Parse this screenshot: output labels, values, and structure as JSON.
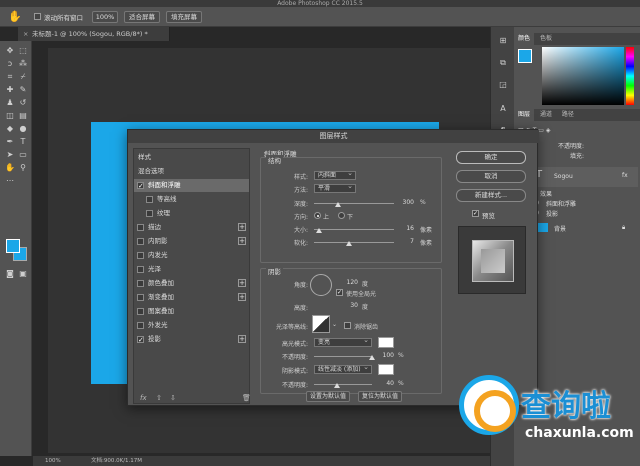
{
  "window": {
    "title": "Adobe Photoshop CC 2015.5"
  },
  "options_bar": {
    "scroll_all_label": "滚动所有窗口",
    "zoom_button": "100%",
    "fit_screen_button": "适合屏幕",
    "fill_screen_button": "填充屏幕"
  },
  "document_tab": {
    "title": "未标题-1 @ 100% (Sogou, RGB/8*) *"
  },
  "status_bar": {
    "zoom": "100%",
    "doc_info": "文档:900.0K/1.17M"
  },
  "colors": {
    "accent": "#1ba7e8",
    "panel": "#535353",
    "dark": "#282828"
  },
  "right_panel": {
    "color_tabs": [
      "颜色",
      "色板"
    ],
    "mid_tabs": [
      "图层",
      "通道",
      "路径"
    ],
    "layers": {
      "opacity_label": "不透明度:",
      "fill_label": "填充:",
      "text_layer_name": "Sogou",
      "effects_label": "效果",
      "effect_bevel": "斜面和浮雕",
      "effect_shadow": "投影",
      "bg_layer_name": "背景",
      "fx_label": "fx"
    }
  },
  "dialog": {
    "title": "图层样式",
    "style_items": [
      {
        "label": "样式"
      },
      {
        "label": "混合选项"
      },
      {
        "label": "斜面和浮雕"
      },
      {
        "label": "等高线"
      },
      {
        "label": "纹理"
      },
      {
        "label": "描边"
      },
      {
        "label": "内阴影"
      },
      {
        "label": "内发光"
      },
      {
        "label": "光泽"
      },
      {
        "label": "颜色叠加"
      },
      {
        "label": "渐变叠加"
      },
      {
        "label": "图案叠加"
      },
      {
        "label": "外发光"
      },
      {
        "label": "投影"
      }
    ],
    "bevel": {
      "section_title": "斜面和浮雕",
      "structure_title": "结构",
      "style_label": "样式:",
      "style_value": "内斜面",
      "technique_label": "方法:",
      "technique_value": "平滑",
      "depth_label": "深度:",
      "depth_value": "300",
      "depth_unit": "%",
      "depth_pct": 0.3,
      "direction_label": "方向:",
      "dir_up": "上",
      "dir_down": "下",
      "size_label": "大小:",
      "size_value": "16",
      "size_unit": "像素",
      "size_pct": 0.06,
      "soften_label": "软化:",
      "soften_value": "7",
      "soften_unit": "像素",
      "soften_pct": 0.44
    },
    "shading": {
      "title": "阴影",
      "angle_label": "角度:",
      "angle_value": "120",
      "angle_unit": "度",
      "global_light_label": "使用全局光",
      "altitude_label": "高度:",
      "altitude_value": "30",
      "altitude_unit": "度",
      "gloss_label": "光泽等高线:",
      "antialias_label": "消除锯齿",
      "highlight_label": "高光模式:",
      "highlight_mode": "变亮",
      "opacity_label": "不透明度:",
      "hl_opacity_value": "100",
      "hl_opacity_pct": 1.0,
      "opacity_unit": "%",
      "shadow_label": "阴影模式:",
      "shadow_mode": "线性减淡 (添加)",
      "sh_opacity_value": "40",
      "sh_opacity_pct": 0.4
    },
    "set_default_button": "设置为默认值",
    "reset_default_button": "复位为默认值",
    "ok_button": "确定",
    "cancel_button": "取消",
    "new_style_button": "新建样式...",
    "preview_label": "预览",
    "bottom_fx": "fx"
  },
  "watermark": {
    "name": "查询啦",
    "url": "chaxunla.com"
  }
}
